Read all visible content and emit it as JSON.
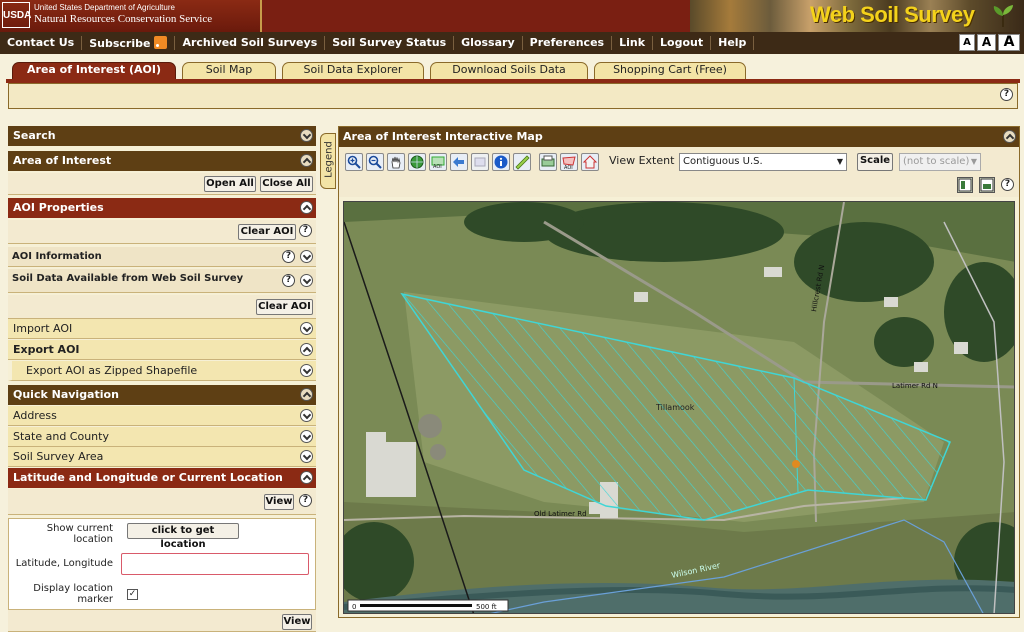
{
  "banner": {
    "usda_logo": "USDA",
    "agency_line1": "United States Department of Agriculture",
    "agency_line2": "Natural Resources Conservation Service",
    "site_title": "Web Soil Survey"
  },
  "topnav": {
    "items": [
      "Contact Us",
      "Subscribe",
      "Archived Soil Surveys",
      "Soil Survey Status",
      "Glossary",
      "Preferences",
      "Link",
      "Logout",
      "Help"
    ],
    "font_sizes": [
      "A",
      "A",
      "A"
    ]
  },
  "tabs": [
    {
      "label": "Area of Interest (AOI)",
      "active": true
    },
    {
      "label": "Soil Map",
      "active": false
    },
    {
      "label": "Soil Data Explorer",
      "active": false
    },
    {
      "label": "Download Soils Data",
      "active": false
    },
    {
      "label": "Shopping Cart (Free)",
      "active": false
    }
  ],
  "help_symbol": "?",
  "left": {
    "search": "Search",
    "aoi_title": "Area of Interest",
    "open_all": "Open All",
    "close_all": "Close All",
    "aoi_properties": "AOI Properties",
    "clear_aoi": "Clear AOI",
    "aoi_information": "AOI Information",
    "soil_data_available": "Soil Data Available from Web Soil Survey",
    "import_aoi": "Import AOI",
    "export_aoi": "Export AOI",
    "export_shapefile": "Export AOI as Zipped Shapefile",
    "quick_navigation": "Quick Navigation",
    "address": "Address",
    "state_county": "State and County",
    "soil_survey_area": "Soil Survey Area",
    "lat_long_location": "Latitude and Longitude or Current Location",
    "view": "View",
    "show_current_location": "Show current location",
    "get_location": "click to get location",
    "latitude_longitude": "Latitude, Longitude",
    "latlong_value": "",
    "display_location_marker": "Display location marker",
    "marker_checked": "✓"
  },
  "legend_label": "Legend",
  "map": {
    "title": "Area of Interest Interactive Map",
    "view_extent_label": "View Extent",
    "view_extent_value": "Contiguous U.S.",
    "scale_label": "Scale",
    "scale_value": "(not to scale)",
    "labels": {
      "aoi_name": "Tillamook",
      "road1": "Latimer Rd N",
      "road2": "Hillcrest Rd N",
      "road3": "Old Latimer Rd",
      "river": "Wilson River"
    },
    "scalebar_start": "0",
    "scalebar_end": "500 ft",
    "tools": [
      "zoom-in-icon",
      "zoom-out-icon",
      "pan-icon",
      "globe-icon",
      "aoi-rect-icon",
      "back-icon",
      "forward-icon",
      "info-icon",
      "measure-icon",
      "print-icon",
      "aoi-polygon-icon",
      "home-icon"
    ]
  },
  "colors": {
    "banner": "#7a1f12",
    "nav": "#3d2a16",
    "header_dark": "#5e3f14",
    "header_red": "#8b2a14",
    "aoi_outline": "#3fd6d6"
  }
}
